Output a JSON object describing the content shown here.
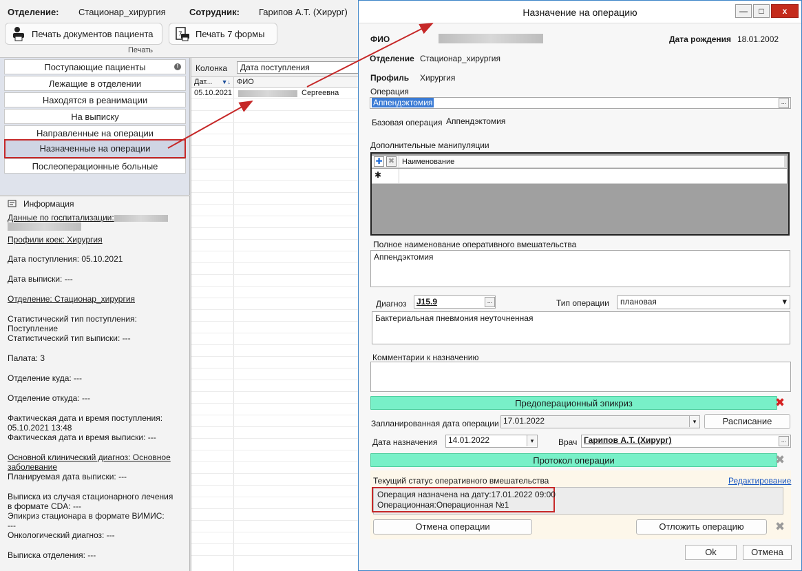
{
  "header": {
    "department_label": "Отделение:",
    "department_value": "Стационар_хирургия",
    "employee_label": "Сотрудник:",
    "employee_value": "Гарипов А.Т. (Хирург)"
  },
  "toolbar": {
    "print_docs_label": "Печать документов пациента",
    "print_form7_label": "Печать 7 формы",
    "group_caption": "Печать"
  },
  "nav": {
    "items": [
      {
        "label": "Поступающие пациенты"
      },
      {
        "label": "Лежащие в отделении"
      },
      {
        "label": "Находятся в реанимации"
      },
      {
        "label": "На выписку"
      },
      {
        "label": "Направленные на операции"
      },
      {
        "label": "Назначенные на операции"
      },
      {
        "label": "Послеоперационные больные"
      }
    ],
    "info_dot": "!"
  },
  "grid": {
    "column_label": "Колонка",
    "column_value": "Дата поступления",
    "headers": [
      "Дат...",
      "ФИО"
    ],
    "sort_glyph": "▼↓",
    "rows": [
      {
        "date": "05.10.2021",
        "name": "Сергеевна"
      }
    ]
  },
  "info": {
    "title": "Информация",
    "lines": [
      "Данные по госпитализации:",
      "Профили коек: Хирургия",
      "Дата поступления: 05.10.2021",
      "Дата выписки: ---",
      "Отделение: Стационар_хирургия",
      "Статистический тип поступления:",
      "Поступление",
      "Статистический тип выписки: ---",
      "Палата: 3",
      "Отделение куда: ---",
      "Отделение откуда: ---",
      "Фактическая дата и время поступления:",
      "05.10.2021 13:48",
      "Фактическая дата и время выписки: ---",
      "Основной клинический диагноз: Основное",
      "заболевание",
      "Планируемая дата выписки: ---",
      "Выписка из случая стационарного лечения",
      "в формате CDA: ---",
      "Эпикриз стационара в формате ВИМИС:",
      "---",
      "Онкологический диагноз: ---",
      "Выписка отделения: ---"
    ]
  },
  "dialog": {
    "title": "Назначение на операцию",
    "win_minimize": "—",
    "win_maximize": "□",
    "win_close": "x",
    "fio_label": "ФИО",
    "birth_label": "Дата рождения",
    "birth_value": "18.01.2002",
    "dept_label": "Отделение",
    "dept_value": "Стационар_хирургия",
    "profile_label": "Профиль",
    "profile_value": "Хирургия",
    "operation_label": "Операция",
    "operation_value": "Аппендэктомия",
    "base_op_label": "Базовая операция",
    "base_op_value": "Аппендэктомия",
    "extra_label": "Дополнительные манипуляции",
    "extra_col": "Наименование",
    "extra_new_row": "✱",
    "fullname_label": "Полное наименование оперативного вмешательства",
    "fullname_value": "Аппендэктомия",
    "diag_label": "Диагноз",
    "diag_code": "J15.9",
    "optype_label": "Тип операции",
    "optype_value": "плановая",
    "diag_text": "Бактериальная пневмония неуточненная",
    "comment_label": "Комментарии к назначению",
    "comment_value": "",
    "preop_label": "Предоперационный эпикриз",
    "planned_label": "Запланированная дата операции",
    "planned_value": "17.01.2022",
    "schedule_button": "Расписание",
    "assign_label": "Дата назначения",
    "assign_value": "14.01.2022",
    "doctor_label": "Врач",
    "doctor_value": "Гарипов А.Т. (Хирург)",
    "protocol_label": "Протокол операции",
    "status_label": "Текущий статус оперативного вмешательства",
    "edit_link": "Редактирование",
    "status_line1": "Операция назначена на дату:17.01.2022 09:00",
    "status_line2": "Операционная:Операционная №1",
    "cancel_op_button": "Отмена операции",
    "postpone_button": "Отложить операцию",
    "ok_button": "Ok",
    "cancel_button": "Отмена",
    "ellipsis": "...",
    "dropdown_glyph": "▾",
    "x_glyph": "✖",
    "plus_glyph": "✚"
  },
  "colors": {
    "accent_green": "#78f0c8",
    "highlight_red": "#c62828",
    "link_blue": "#1a57c2"
  }
}
